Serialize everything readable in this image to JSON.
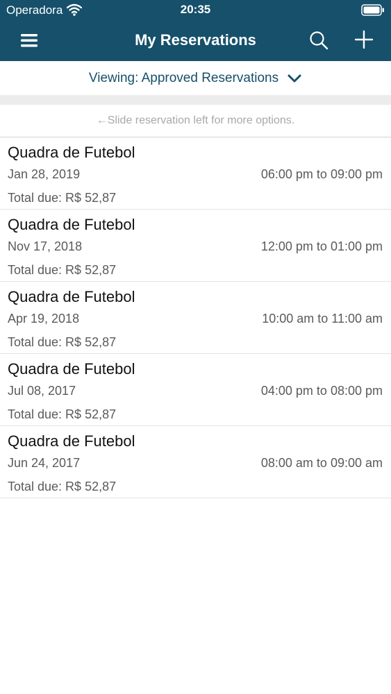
{
  "status_bar": {
    "carrier": "Operadora",
    "time": "20:35",
    "wifi_icon": "wifi-icon",
    "battery_icon": "battery-icon"
  },
  "nav": {
    "title": "My Reservations",
    "menu_icon": "hamburger-menu-icon",
    "search_icon": "search-icon",
    "add_icon": "plus-icon"
  },
  "filter": {
    "label": "Viewing: Approved Reservations",
    "icon": "chevron-down-icon"
  },
  "hint": "←Slide reservation left for more options.",
  "reservations": [
    {
      "title": "Quadra de Futebol",
      "date": "Jan 28, 2019",
      "time": "06:00 pm to 09:00 pm",
      "total": "Total due: R$ 52,87"
    },
    {
      "title": "Quadra de Futebol",
      "date": "Nov 17, 2018",
      "time": "12:00 pm to 01:00 pm",
      "total": "Total due: R$ 52,87"
    },
    {
      "title": "Quadra de Futebol",
      "date": "Apr 19, 2018",
      "time": "10:00 am to 11:00 am",
      "total": "Total due: R$ 52,87"
    },
    {
      "title": "Quadra de Futebol",
      "date": "Jul 08, 2017",
      "time": "04:00 pm to 08:00 pm",
      "total": "Total due: R$ 52,87"
    },
    {
      "title": "Quadra de Futebol",
      "date": "Jun 24, 2017",
      "time": "08:00 am to 09:00 am",
      "total": "Total due: R$ 52,87"
    }
  ],
  "colors": {
    "header_background": "#16506b",
    "header_text": "#ffffff",
    "accent": "#16506b",
    "hint_text": "#a8a8a8",
    "separator": "#ececec"
  }
}
